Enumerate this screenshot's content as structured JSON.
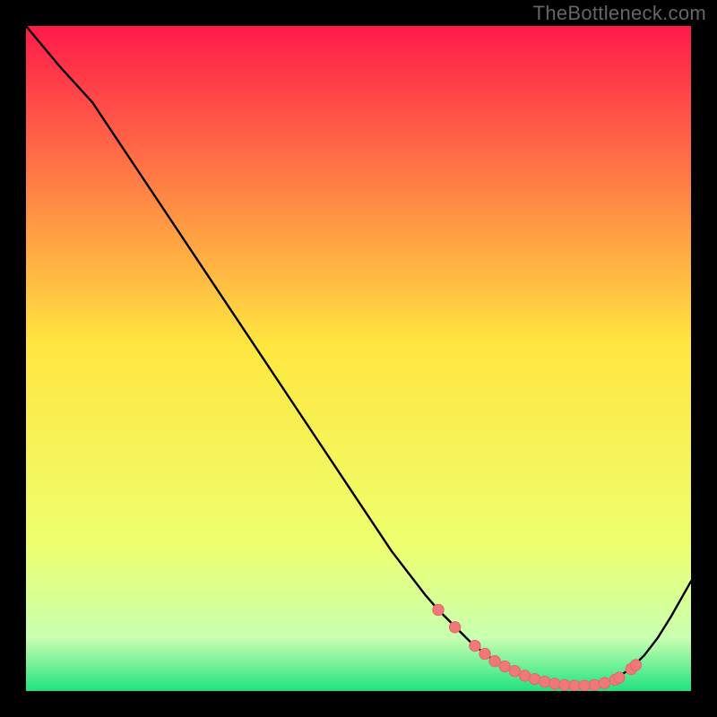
{
  "watermark": "TheBottleneck.com",
  "colors": {
    "frame": "#000000",
    "curve": "#000000",
    "dot_fill": "#ef7878",
    "dot_stroke": "#de6a6a",
    "grad_top": "#ff1a4a",
    "grad_mid": "#ffe640",
    "grad_low1": "#edff6e",
    "grad_low2": "#c9ffb0",
    "grad_bottom": "#20e282"
  },
  "chart_data": {
    "type": "line",
    "title": "",
    "xlabel": "",
    "ylabel": "",
    "xlim": [
      0,
      100
    ],
    "ylim": [
      0,
      100
    ],
    "grid": false,
    "legend": false,
    "series": [
      {
        "name": "curve",
        "x": [
          0,
          5,
          10,
          15,
          20,
          25,
          30,
          35,
          40,
          45,
          50,
          55,
          60,
          62,
          65,
          67,
          69,
          71,
          73,
          75,
          77,
          79,
          80,
          81,
          83,
          85,
          87,
          88,
          89,
          91,
          93,
          95,
          97,
          100
        ],
        "y": [
          100,
          94,
          88.5,
          81,
          73.5,
          66,
          58.5,
          51,
          43.5,
          36,
          28.5,
          21,
          14.5,
          12.2,
          9.2,
          7.2,
          5.6,
          4.2,
          3.1,
          2.3,
          1.6,
          1.1,
          0.9,
          0.8,
          0.8,
          0.9,
          1.2,
          1.6,
          2.1,
          3.4,
          5.4,
          8.0,
          11.2,
          16.5
        ]
      }
    ],
    "dots": {
      "x": [
        62.0,
        64.5,
        67.5,
        69.0,
        70.5,
        72.0,
        73.5,
        75.0,
        76.5,
        78.0,
        79.5,
        81.0,
        82.5,
        84.0,
        85.5,
        87.0,
        88.6,
        89.2,
        91.0,
        91.7
      ],
      "y": [
        12.2,
        9.6,
        6.8,
        5.6,
        4.5,
        3.7,
        3.0,
        2.3,
        1.8,
        1.4,
        1.1,
        0.9,
        0.8,
        0.8,
        0.9,
        1.2,
        1.7,
        2.0,
        3.3,
        3.9
      ]
    }
  }
}
